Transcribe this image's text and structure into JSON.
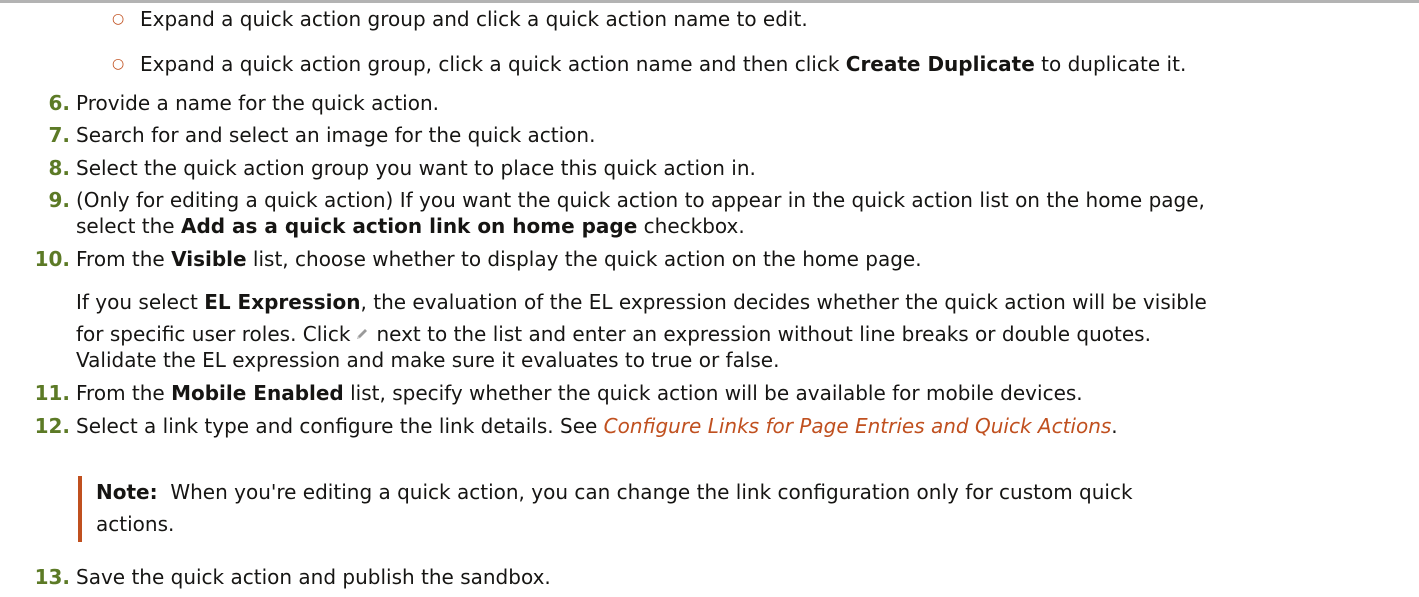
{
  "substeps": [
    {
      "pre": "Expand a quick action group and click a quick action name to edit.",
      "bold": "",
      "post": ""
    },
    {
      "pre": "Expand a quick action group, click a quick action name and then click ",
      "bold": "Create Duplicate",
      "post": " to duplicate it."
    }
  ],
  "steps": {
    "s6": {
      "num": "6.",
      "text": "Provide a name for the quick action."
    },
    "s7": {
      "num": "7.",
      "text": "Search for and select an image for the quick action."
    },
    "s8": {
      "num": "8.",
      "text": "Select the quick action group you want to place this quick action in."
    },
    "s9": {
      "num": "9.",
      "line1": "(Only for editing a quick action) If you want the quick action to appear in the quick action list on the home page,",
      "line2_pre": "select the ",
      "line2_bold": "Add as a quick action link on home page",
      "line2_post": " checkbox."
    },
    "s10": {
      "num": "10.",
      "pre": "From the ",
      "bold": "Visible",
      "post": " list, choose whether to display the quick action on the home page.",
      "para_l1_pre": "If you select ",
      "para_l1_bold": "EL Expression",
      "para_l1_post": ", the evaluation of the EL expression decides whether the quick action will be visible",
      "para_l2_pre": "for specific user roles. Click",
      "para_l2_post": "next to the list and enter an expression without line breaks or double quotes.",
      "para_l3": "Validate the EL expression and make sure it evaluates to true or false."
    },
    "s11": {
      "num": "11.",
      "pre": "From the ",
      "bold": "Mobile Enabled",
      "post": " list, specify whether the quick action will be available for mobile devices."
    },
    "s12": {
      "num": "12.",
      "pre": "Select a link type and configure the link details. See ",
      "link": "Configure Links for Page Entries and Quick Actions",
      "post": "."
    },
    "s13": {
      "num": "13.",
      "text": "Save the quick action and publish the sandbox."
    }
  },
  "note": {
    "label": "Note:",
    "line1": "When you're editing a quick action, you can change the link configuration only for custom quick",
    "line2": "actions."
  },
  "icons": {
    "pencil": "pencil-icon",
    "bullet": "hollow-circle-bullet"
  },
  "colors": {
    "accent": "#c0501f",
    "step_number": "#5c7a26",
    "text": "#161513"
  }
}
